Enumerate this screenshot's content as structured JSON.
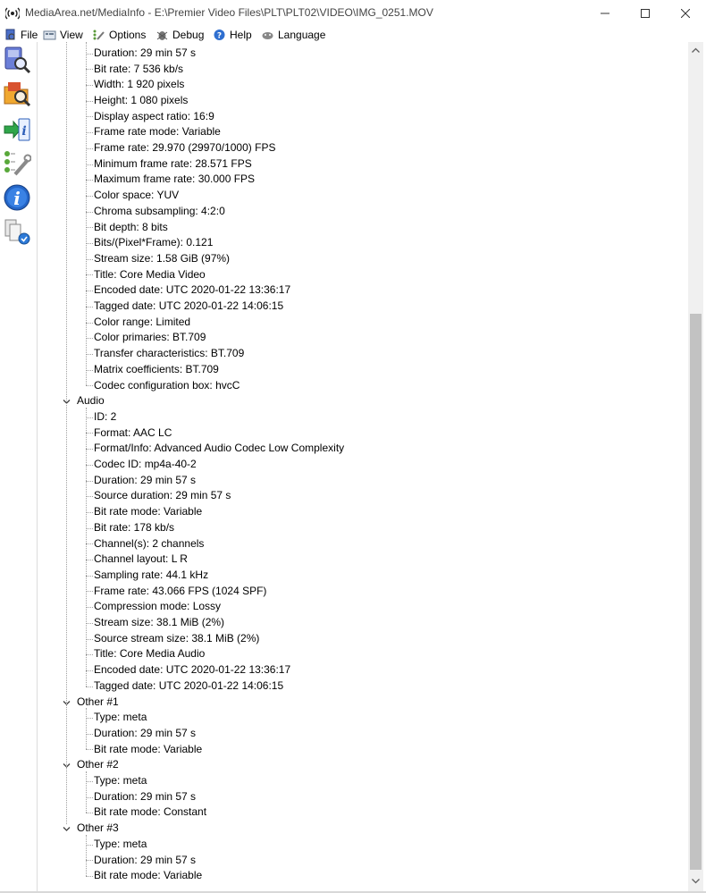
{
  "window": {
    "title": "MediaArea.net/MediaInfo - E:\\Premier Video Files\\PLT\\PLT02\\VIDEO\\IMG_0251.MOV"
  },
  "menu": [
    {
      "label": "File",
      "icon": "mediainfo-icon"
    },
    {
      "label": "View",
      "icon": "view-icon"
    },
    {
      "label": "Options",
      "icon": "options-icon"
    },
    {
      "label": "Debug",
      "icon": "debug-icon"
    },
    {
      "label": "Help",
      "icon": "help-icon"
    },
    {
      "label": "Language",
      "icon": "language-icon"
    }
  ],
  "toolbar": [
    {
      "icon": "open-file-icon"
    },
    {
      "icon": "open-folder-icon"
    },
    {
      "icon": "export-icon"
    },
    {
      "icon": "preferences-icon"
    },
    {
      "icon": "about-icon"
    },
    {
      "icon": "knowledge-icon"
    }
  ],
  "video_rows": [
    "Duration: 29 min 57 s",
    "Bit rate: 7 536 kb/s",
    "Width: 1 920 pixels",
    "Height: 1 080 pixels",
    "Display aspect ratio: 16:9",
    "Frame rate mode: Variable",
    "Frame rate: 29.970 (29970/1000) FPS",
    "Minimum frame rate: 28.571 FPS",
    "Maximum frame rate: 30.000 FPS",
    "Color space: YUV",
    "Chroma subsampling: 4:2:0",
    "Bit depth: 8 bits",
    "Bits/(Pixel*Frame): 0.121",
    "Stream size: 1.58 GiB (97%)",
    "Title: Core Media Video",
    "Encoded date: UTC 2020-01-22 13:36:17",
    "Tagged date: UTC 2020-01-22 14:06:15",
    "Color range: Limited",
    "Color primaries: BT.709",
    "Transfer characteristics: BT.709",
    "Matrix coefficients: BT.709",
    "Codec configuration box: hvcC"
  ],
  "sections": [
    {
      "name": "Audio",
      "rows": [
        "ID: 2",
        "Format: AAC LC",
        "Format/Info: Advanced Audio Codec Low Complexity",
        "Codec ID: mp4a-40-2",
        "Duration: 29 min 57 s",
        "Source duration: 29 min 57 s",
        "Bit rate mode: Variable",
        "Bit rate: 178 kb/s",
        "Channel(s): 2 channels",
        "Channel layout: L R",
        "Sampling rate: 44.1 kHz",
        "Frame rate: 43.066 FPS (1024 SPF)",
        "Compression mode: Lossy",
        "Stream size: 38.1 MiB (2%)",
        "Source stream size: 38.1 MiB (2%)",
        "Title: Core Media Audio",
        "Encoded date: UTC 2020-01-22 13:36:17",
        "Tagged date: UTC 2020-01-22 14:06:15"
      ]
    },
    {
      "name": "Other #1",
      "rows": [
        "Type: meta",
        "Duration: 29 min 57 s",
        "Bit rate mode: Variable"
      ]
    },
    {
      "name": "Other #2",
      "rows": [
        "Type: meta",
        "Duration: 29 min 57 s",
        "Bit rate mode: Constant"
      ]
    },
    {
      "name": "Other #3",
      "rows": [
        "Type: meta",
        "Duration: 29 min 57 s",
        "Bit rate mode: Variable"
      ]
    }
  ]
}
